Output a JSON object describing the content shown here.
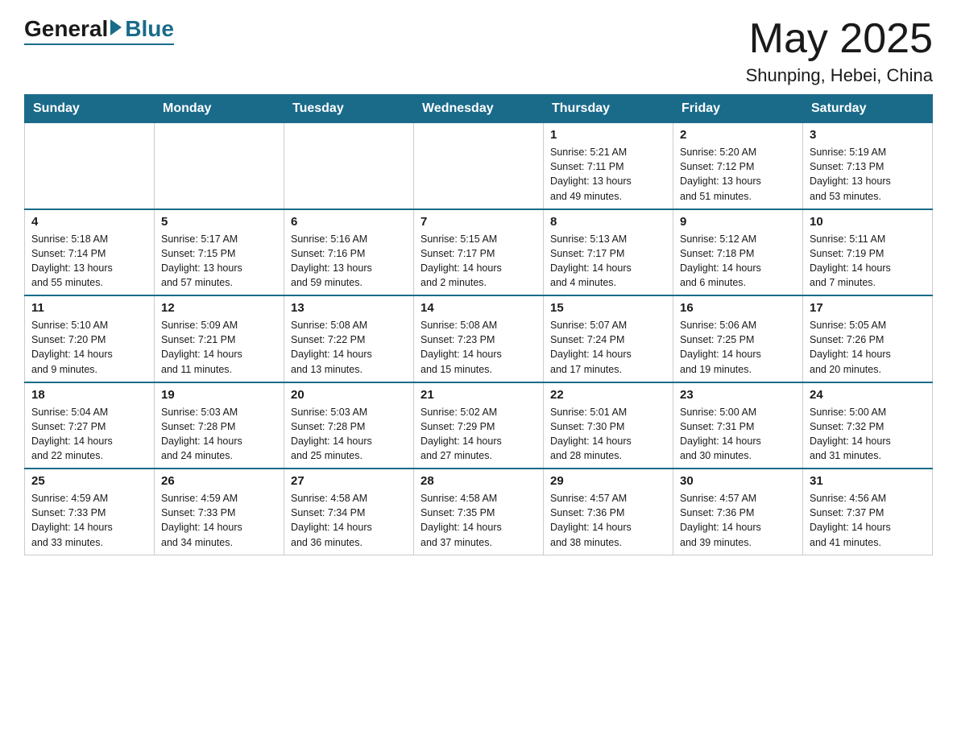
{
  "header": {
    "logo_general": "General",
    "logo_blue": "Blue",
    "month_title": "May 2025",
    "location": "Shunping, Hebei, China"
  },
  "days_of_week": [
    "Sunday",
    "Monday",
    "Tuesday",
    "Wednesday",
    "Thursday",
    "Friday",
    "Saturday"
  ],
  "weeks": [
    [
      {
        "day": "",
        "info": ""
      },
      {
        "day": "",
        "info": ""
      },
      {
        "day": "",
        "info": ""
      },
      {
        "day": "",
        "info": ""
      },
      {
        "day": "1",
        "info": "Sunrise: 5:21 AM\nSunset: 7:11 PM\nDaylight: 13 hours\nand 49 minutes."
      },
      {
        "day": "2",
        "info": "Sunrise: 5:20 AM\nSunset: 7:12 PM\nDaylight: 13 hours\nand 51 minutes."
      },
      {
        "day": "3",
        "info": "Sunrise: 5:19 AM\nSunset: 7:13 PM\nDaylight: 13 hours\nand 53 minutes."
      }
    ],
    [
      {
        "day": "4",
        "info": "Sunrise: 5:18 AM\nSunset: 7:14 PM\nDaylight: 13 hours\nand 55 minutes."
      },
      {
        "day": "5",
        "info": "Sunrise: 5:17 AM\nSunset: 7:15 PM\nDaylight: 13 hours\nand 57 minutes."
      },
      {
        "day": "6",
        "info": "Sunrise: 5:16 AM\nSunset: 7:16 PM\nDaylight: 13 hours\nand 59 minutes."
      },
      {
        "day": "7",
        "info": "Sunrise: 5:15 AM\nSunset: 7:17 PM\nDaylight: 14 hours\nand 2 minutes."
      },
      {
        "day": "8",
        "info": "Sunrise: 5:13 AM\nSunset: 7:17 PM\nDaylight: 14 hours\nand 4 minutes."
      },
      {
        "day": "9",
        "info": "Sunrise: 5:12 AM\nSunset: 7:18 PM\nDaylight: 14 hours\nand 6 minutes."
      },
      {
        "day": "10",
        "info": "Sunrise: 5:11 AM\nSunset: 7:19 PM\nDaylight: 14 hours\nand 7 minutes."
      }
    ],
    [
      {
        "day": "11",
        "info": "Sunrise: 5:10 AM\nSunset: 7:20 PM\nDaylight: 14 hours\nand 9 minutes."
      },
      {
        "day": "12",
        "info": "Sunrise: 5:09 AM\nSunset: 7:21 PM\nDaylight: 14 hours\nand 11 minutes."
      },
      {
        "day": "13",
        "info": "Sunrise: 5:08 AM\nSunset: 7:22 PM\nDaylight: 14 hours\nand 13 minutes."
      },
      {
        "day": "14",
        "info": "Sunrise: 5:08 AM\nSunset: 7:23 PM\nDaylight: 14 hours\nand 15 minutes."
      },
      {
        "day": "15",
        "info": "Sunrise: 5:07 AM\nSunset: 7:24 PM\nDaylight: 14 hours\nand 17 minutes."
      },
      {
        "day": "16",
        "info": "Sunrise: 5:06 AM\nSunset: 7:25 PM\nDaylight: 14 hours\nand 19 minutes."
      },
      {
        "day": "17",
        "info": "Sunrise: 5:05 AM\nSunset: 7:26 PM\nDaylight: 14 hours\nand 20 minutes."
      }
    ],
    [
      {
        "day": "18",
        "info": "Sunrise: 5:04 AM\nSunset: 7:27 PM\nDaylight: 14 hours\nand 22 minutes."
      },
      {
        "day": "19",
        "info": "Sunrise: 5:03 AM\nSunset: 7:28 PM\nDaylight: 14 hours\nand 24 minutes."
      },
      {
        "day": "20",
        "info": "Sunrise: 5:03 AM\nSunset: 7:28 PM\nDaylight: 14 hours\nand 25 minutes."
      },
      {
        "day": "21",
        "info": "Sunrise: 5:02 AM\nSunset: 7:29 PM\nDaylight: 14 hours\nand 27 minutes."
      },
      {
        "day": "22",
        "info": "Sunrise: 5:01 AM\nSunset: 7:30 PM\nDaylight: 14 hours\nand 28 minutes."
      },
      {
        "day": "23",
        "info": "Sunrise: 5:00 AM\nSunset: 7:31 PM\nDaylight: 14 hours\nand 30 minutes."
      },
      {
        "day": "24",
        "info": "Sunrise: 5:00 AM\nSunset: 7:32 PM\nDaylight: 14 hours\nand 31 minutes."
      }
    ],
    [
      {
        "day": "25",
        "info": "Sunrise: 4:59 AM\nSunset: 7:33 PM\nDaylight: 14 hours\nand 33 minutes."
      },
      {
        "day": "26",
        "info": "Sunrise: 4:59 AM\nSunset: 7:33 PM\nDaylight: 14 hours\nand 34 minutes."
      },
      {
        "day": "27",
        "info": "Sunrise: 4:58 AM\nSunset: 7:34 PM\nDaylight: 14 hours\nand 36 minutes."
      },
      {
        "day": "28",
        "info": "Sunrise: 4:58 AM\nSunset: 7:35 PM\nDaylight: 14 hours\nand 37 minutes."
      },
      {
        "day": "29",
        "info": "Sunrise: 4:57 AM\nSunset: 7:36 PM\nDaylight: 14 hours\nand 38 minutes."
      },
      {
        "day": "30",
        "info": "Sunrise: 4:57 AM\nSunset: 7:36 PM\nDaylight: 14 hours\nand 39 minutes."
      },
      {
        "day": "31",
        "info": "Sunrise: 4:56 AM\nSunset: 7:37 PM\nDaylight: 14 hours\nand 41 minutes."
      }
    ]
  ]
}
